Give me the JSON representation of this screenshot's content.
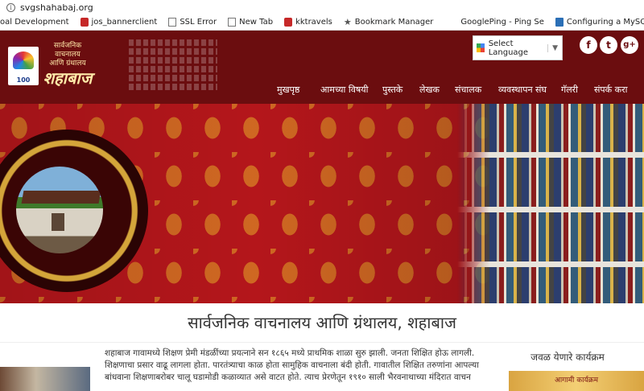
{
  "browser": {
    "url": "svgshahabaj.org",
    "bookmarks": [
      "oal Development",
      "jos_bannerclient",
      "SSL Error",
      "New Tab",
      "kktravels",
      "Bookmark Manager",
      "GooglePing - Ping Se",
      "Configuring a MySQL"
    ]
  },
  "header": {
    "logo_year": "100",
    "logo_line1": "सार्वजनिक वाचनालय",
    "logo_line2": "आणि ग्रंथालय",
    "logo_name": "शहाबाज",
    "language_label": "Select Language",
    "language_arrow": "▼",
    "social": {
      "facebook": "f",
      "twitter": "t",
      "googleplus": "g+"
    }
  },
  "nav": [
    "मुखपृष्ठ",
    "आमच्या विषयी",
    "पुस्तके",
    "लेखक",
    "संचालक",
    "व्यवस्थापन संघ",
    "गॅलरी",
    "संपर्क करा"
  ],
  "page_title": "सार्वजनिक वाचनालय आणि ग्रंथालय, शहाबाज",
  "intro_lines": [
    "शहाबाज गावामध्ये शिक्षण प्रेमी मंडळींच्या प्रयत्नाने सन १८६५ मध्ये प्राथमिक शाळा सुरु झाली. जनता शिक्षित होऊ लागली.",
    "शिक्षणाचा प्रसार वाढू लागला होता. पारतंत्र्याचा काळ होता सामुहिक वाचनाला बंदी होती. गावातील शिक्षित तरुणांना आपल्या",
    "बांधवाना शिक्षणाबरोबर चालू घडामोडी कळाव्यात असे वाटत होते. त्याच प्रेरणेतून १९१० साली भैरवनाथाच्या मंदिरात वाचन"
  ],
  "events_title": "जवळ येणारे कार्यक्रम",
  "event_card_text": "आगामी कार्यक्रम"
}
